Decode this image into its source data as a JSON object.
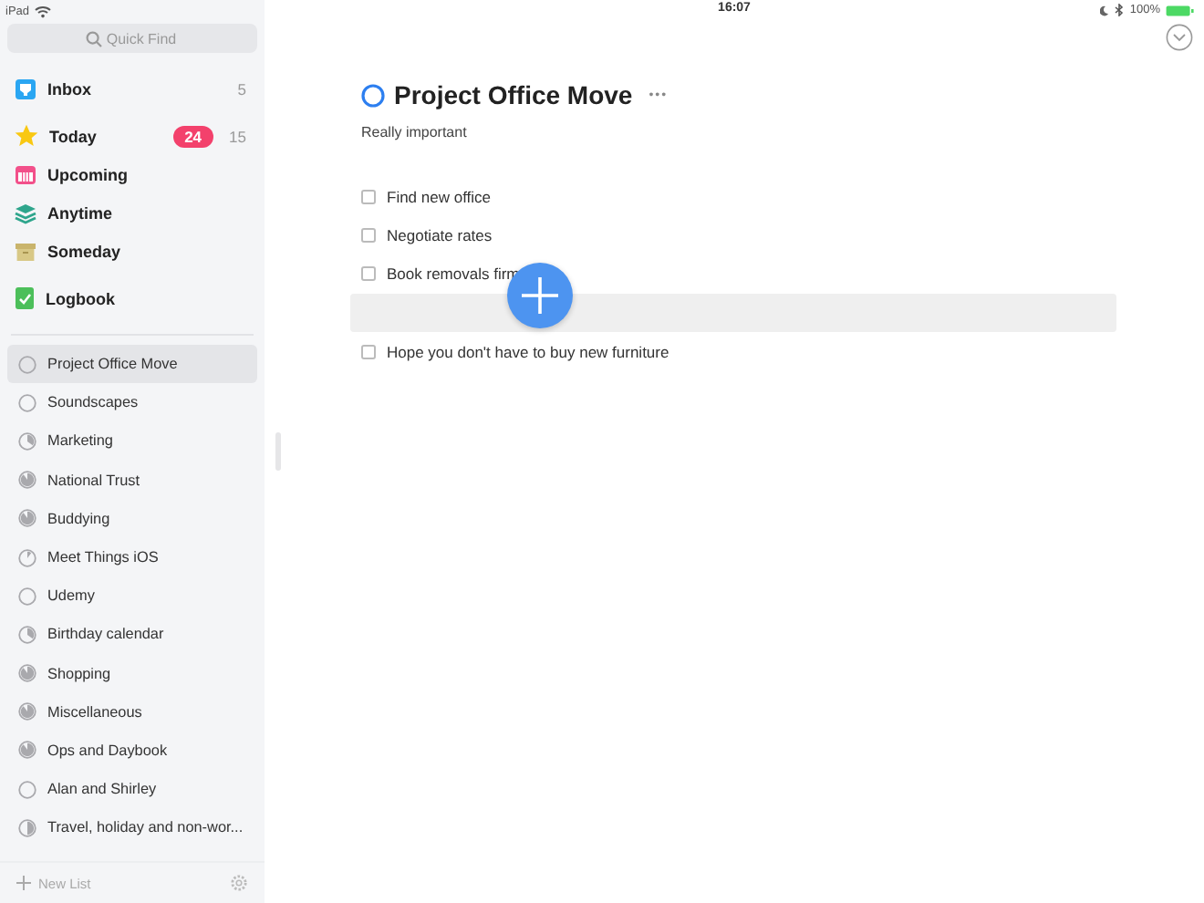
{
  "status_bar": {
    "device": "iPad",
    "time": "16:07",
    "battery": "100%"
  },
  "sidebar": {
    "search": {
      "placeholder": "Quick Find"
    },
    "sections": [
      {
        "kind": "inbox",
        "label": "Inbox",
        "count": "5"
      },
      {
        "kind": "today",
        "label": "Today",
        "badge": "24",
        "count": "15"
      },
      {
        "kind": "upcoming",
        "label": "Upcoming"
      },
      {
        "kind": "anytime",
        "label": "Anytime"
      },
      {
        "kind": "someday",
        "label": "Someday"
      },
      {
        "kind": "logbook",
        "label": "Logbook"
      }
    ],
    "projects": [
      {
        "kind": "open",
        "label": "Project Office Move",
        "selected": true
      },
      {
        "kind": "open",
        "label": "Soundscapes",
        "selected": false
      },
      {
        "kind": "third",
        "label": "Marketing",
        "selected": false
      },
      {
        "kind": "most",
        "label": "National Trust",
        "selected": false
      },
      {
        "kind": "most",
        "label": "Buddying",
        "selected": false
      },
      {
        "kind": "sliver",
        "label": "Meet Things iOS",
        "selected": false
      },
      {
        "kind": "open",
        "label": "Udemy",
        "selected": false
      },
      {
        "kind": "third",
        "label": "Birthday calendar",
        "selected": false
      },
      {
        "kind": "most",
        "label": "Shopping",
        "selected": false
      },
      {
        "kind": "most",
        "label": "Miscellaneous",
        "selected": false
      },
      {
        "kind": "most",
        "label": "Ops and Daybook",
        "selected": false
      },
      {
        "kind": "open",
        "label": "Alan and Shirley",
        "selected": false
      },
      {
        "kind": "half",
        "label": "Travel, holiday and non-wor...",
        "selected": false
      }
    ],
    "new_list": "New List"
  },
  "project": {
    "title": "Project Office Move",
    "more": "•••",
    "notes": "Really important",
    "tasks": [
      {
        "kind": "task",
        "label": "Find new office",
        "checked": false
      },
      {
        "kind": "task",
        "label": "Negotiate rates",
        "checked": false
      },
      {
        "kind": "task",
        "label": "Book removals firm",
        "checked": false
      },
      {
        "kind": "new"
      },
      {
        "kind": "task",
        "label": "Hope you don't have to buy new furniture",
        "checked": false
      }
    ]
  }
}
